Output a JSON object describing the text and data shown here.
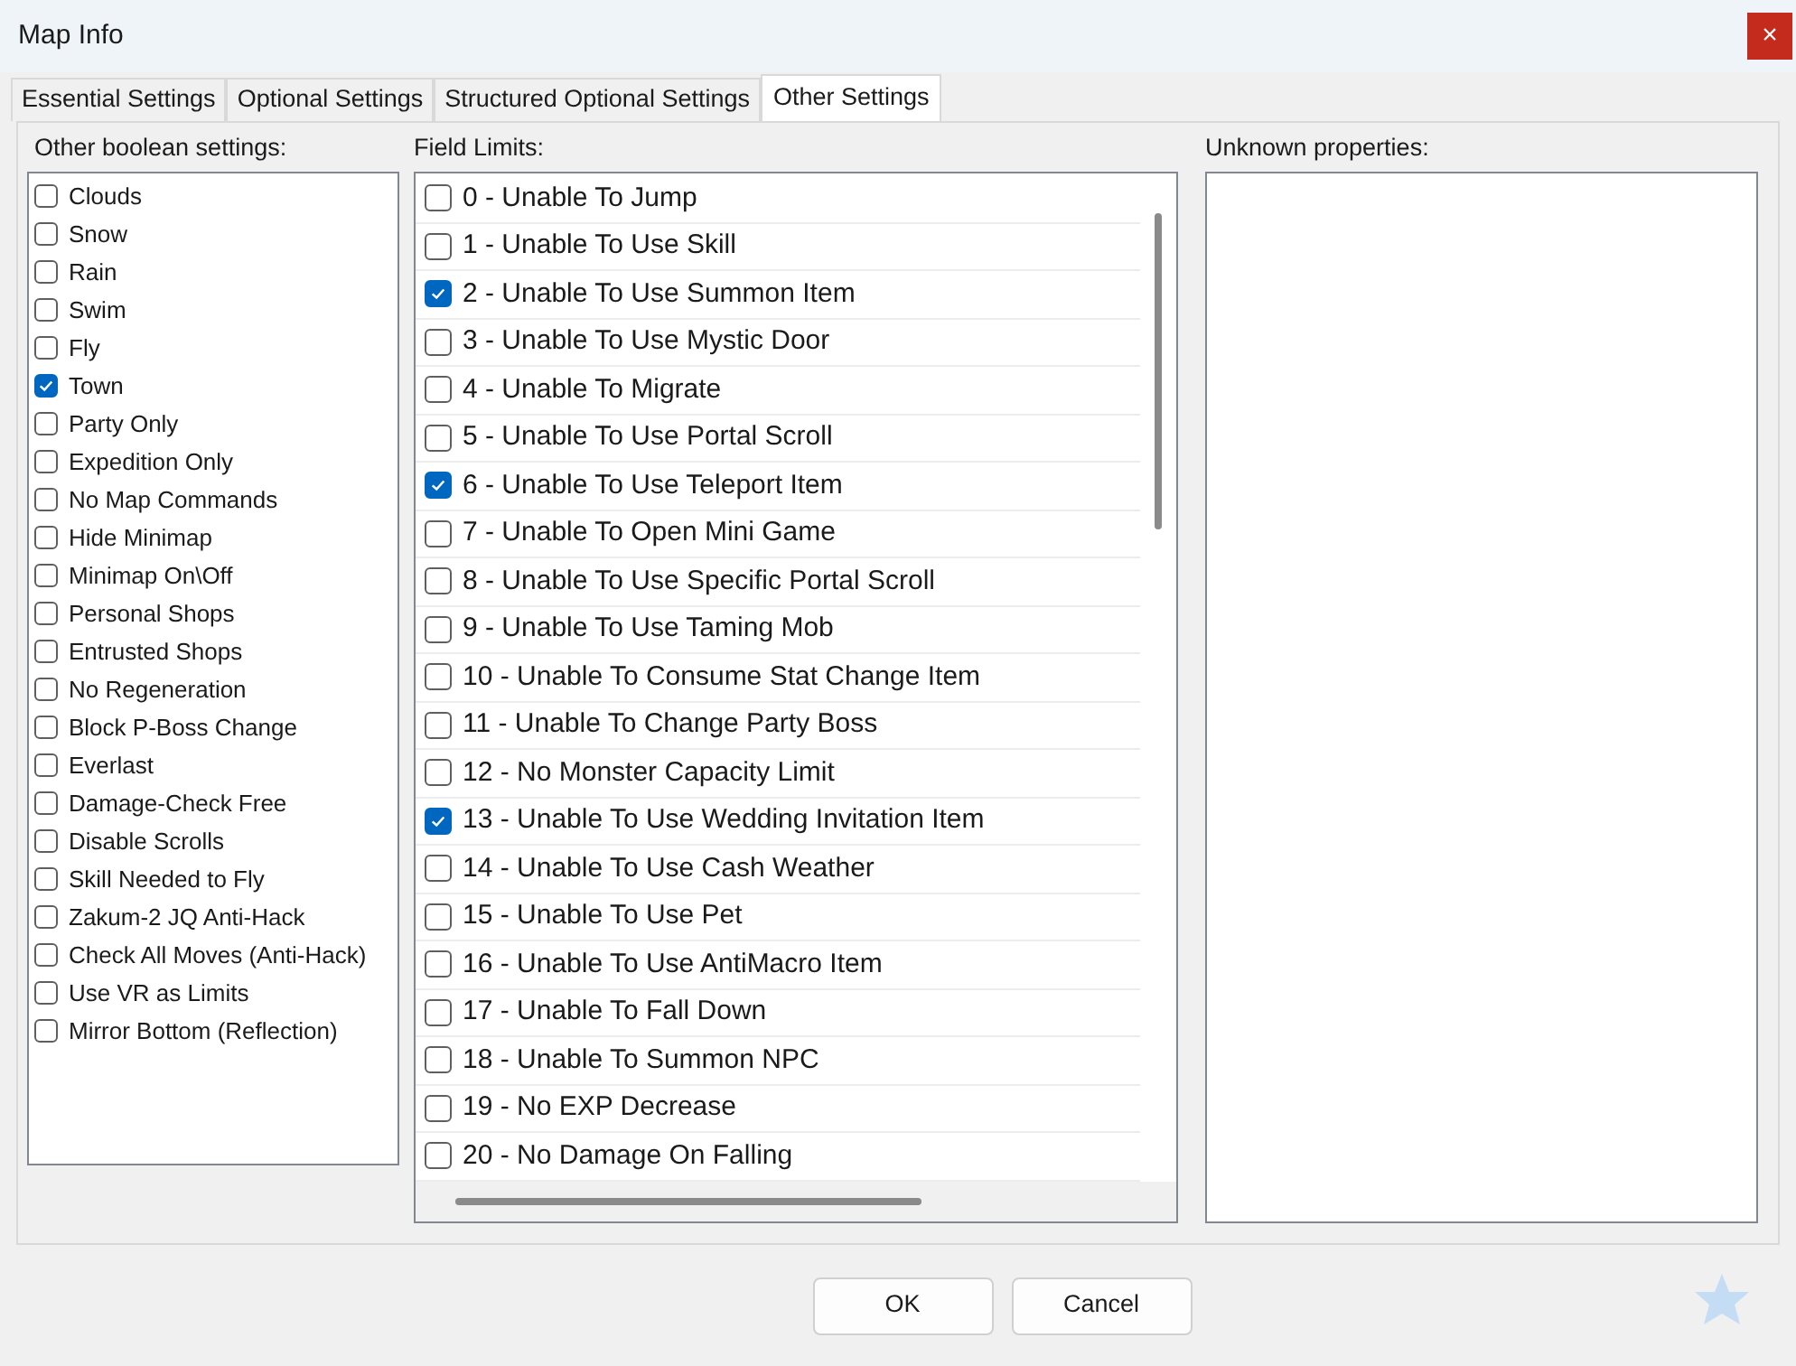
{
  "window": {
    "title": "Map Info",
    "close": "×"
  },
  "tabs": [
    {
      "label": "Essential Settings",
      "selected": false
    },
    {
      "label": "Optional Settings",
      "selected": false
    },
    {
      "label": "Structured Optional Settings",
      "selected": false
    },
    {
      "label": "Other Settings",
      "selected": true
    }
  ],
  "boolean_settings": {
    "label": "Other boolean settings:",
    "items": [
      {
        "label": "Clouds",
        "checked": false
      },
      {
        "label": "Snow",
        "checked": false
      },
      {
        "label": "Rain",
        "checked": false
      },
      {
        "label": "Swim",
        "checked": false
      },
      {
        "label": "Fly",
        "checked": false
      },
      {
        "label": "Town",
        "checked": true
      },
      {
        "label": "Party Only",
        "checked": false
      },
      {
        "label": "Expedition Only",
        "checked": false
      },
      {
        "label": "No Map Commands",
        "checked": false
      },
      {
        "label": "Hide Minimap",
        "checked": false
      },
      {
        "label": "Minimap On\\Off",
        "checked": false
      },
      {
        "label": "Personal Shops",
        "checked": false
      },
      {
        "label": "Entrusted Shops",
        "checked": false
      },
      {
        "label": "No Regeneration",
        "checked": false
      },
      {
        "label": "Block P-Boss Change",
        "checked": false
      },
      {
        "label": "Everlast",
        "checked": false
      },
      {
        "label": "Damage-Check Free",
        "checked": false
      },
      {
        "label": "Disable Scrolls",
        "checked": false
      },
      {
        "label": "Skill Needed to Fly",
        "checked": false
      },
      {
        "label": "Zakum-2 JQ Anti-Hack",
        "checked": false
      },
      {
        "label": "Check All Moves (Anti-Hack)",
        "checked": false
      },
      {
        "label": "Use VR as Limits",
        "checked": false
      },
      {
        "label": "Mirror Bottom (Reflection)",
        "checked": false
      }
    ]
  },
  "field_limits": {
    "label": "Field Limits:",
    "items": [
      {
        "label": "0 - Unable To Jump",
        "checked": false
      },
      {
        "label": "1 - Unable To Use Skill",
        "checked": false
      },
      {
        "label": "2 - Unable To Use Summon Item",
        "checked": true
      },
      {
        "label": "3 - Unable To Use Mystic Door",
        "checked": false
      },
      {
        "label": "4 - Unable To Migrate",
        "checked": false
      },
      {
        "label": "5 - Unable To Use Portal Scroll",
        "checked": false
      },
      {
        "label": "6 - Unable To Use Teleport Item",
        "checked": true
      },
      {
        "label": "7 - Unable To Open Mini Game",
        "checked": false
      },
      {
        "label": "8 - Unable To Use Specific Portal Scroll",
        "checked": false
      },
      {
        "label": "9 - Unable To Use Taming Mob",
        "checked": false
      },
      {
        "label": "10 - Unable To Consume Stat Change Item",
        "checked": false
      },
      {
        "label": "11 - Unable To Change Party Boss",
        "checked": false
      },
      {
        "label": "12 - No Monster Capacity Limit",
        "checked": false
      },
      {
        "label": "13 - Unable To Use Wedding Invitation Item",
        "checked": true
      },
      {
        "label": "14 - Unable To Use Cash Weather",
        "checked": false
      },
      {
        "label": "15 - Unable To Use Pet",
        "checked": false
      },
      {
        "label": "16 - Unable To Use AntiMacro Item",
        "checked": false
      },
      {
        "label": "17 - Unable To Fall Down",
        "checked": false
      },
      {
        "label": "18 - Unable To Summon NPC",
        "checked": false
      },
      {
        "label": "19 - No EXP Decrease",
        "checked": false
      },
      {
        "label": "20 - No Damage On Falling",
        "checked": false
      }
    ]
  },
  "unknown_properties": {
    "label": "Unknown properties:"
  },
  "buttons": [
    "OK",
    "Cancel"
  ]
}
